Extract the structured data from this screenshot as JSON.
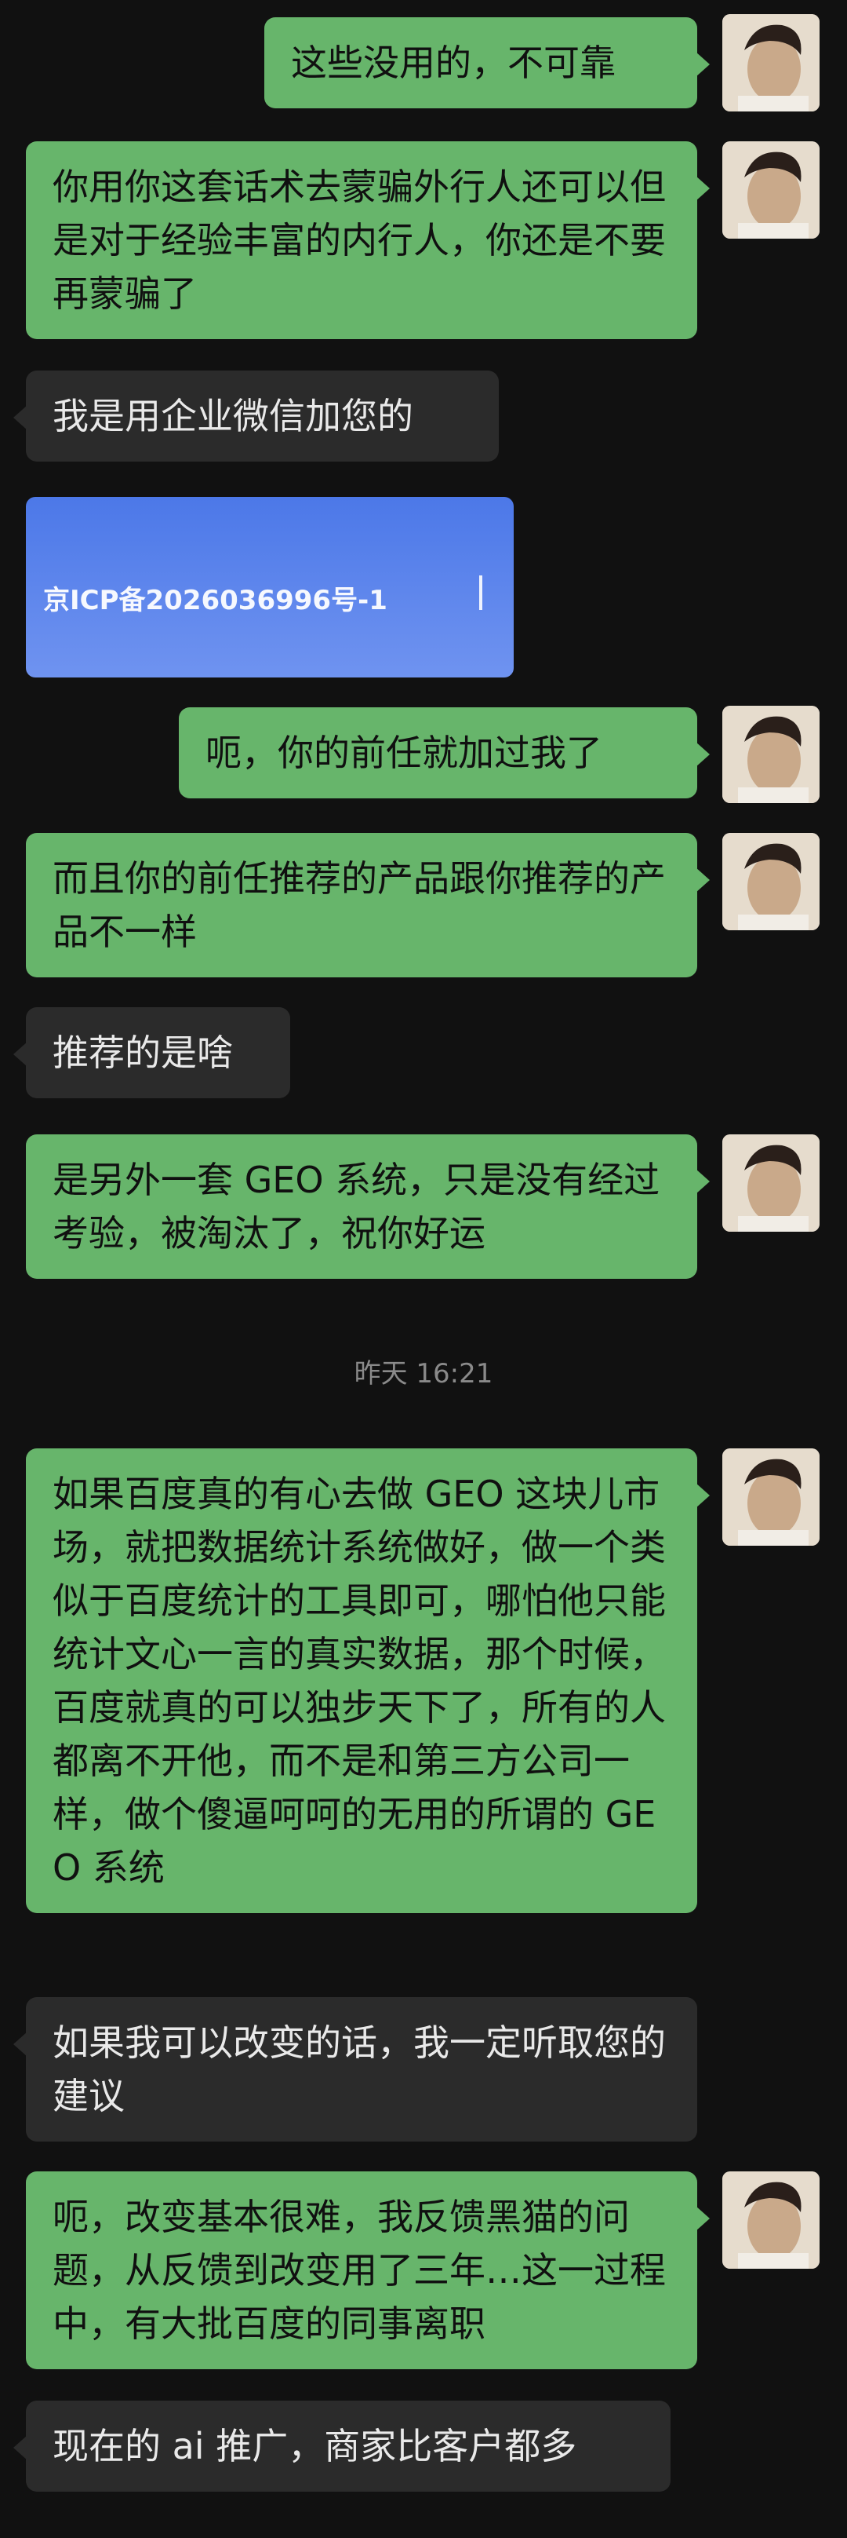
{
  "messages": [
    {
      "side": "out",
      "text": "这些没用的，不可靠"
    },
    {
      "side": "out",
      "text": "你用你这套话术去蒙骗外行人还可以但是对于经验丰富的内行人，你还是不要再蒙骗了"
    },
    {
      "side": "in",
      "text": "我是用企业微信加您的"
    },
    {
      "side": "in",
      "type": "image",
      "text": "京ICP备2026036996号-1"
    },
    {
      "side": "out",
      "text": "呃，你的前任就加过我了"
    },
    {
      "side": "out",
      "text": "而且你的前任推荐的产品跟你推荐的产品不一样"
    },
    {
      "side": "in",
      "text": "推荐的是啥"
    },
    {
      "side": "out",
      "text": "是另外一套 GEO 系统，只是没有经过考验，被淘汰了，祝你好运"
    },
    {
      "side": "out",
      "text": "如果百度真的有心去做 GEO 这块儿市场，就把数据统计系统做好，做一个类似于百度统计的工具即可，哪怕他只能统计文心一言的真实数据，那个时候，百度就真的可以独步天下了，所有的人都离不开他，而不是和第三方公司一样，做个傻逼呵呵的无用的所谓的 GEO 系统"
    },
    {
      "side": "in",
      "text": "如果我可以改变的话，我一定听取您的建议"
    },
    {
      "side": "out",
      "text": "呃，改变基本很难，我反馈黑猫的问题，从反馈到改变用了三年…这一过程中，有大批百度的同事离职"
    },
    {
      "side": "in",
      "text": "现在的 ai 推广，商家比客户都多"
    }
  ],
  "timestamp": "昨天 16:21"
}
